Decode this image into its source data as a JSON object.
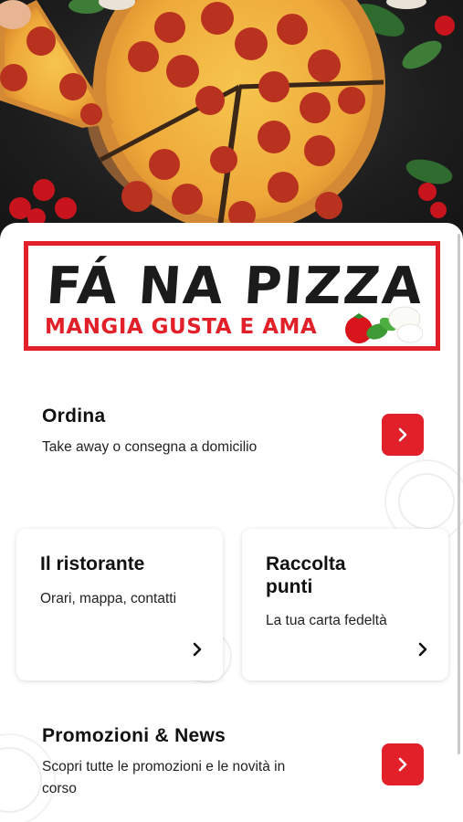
{
  "hero": {
    "image": "pepperoni-pizza-photo"
  },
  "logo": {
    "title": "FÁ NA PIZZA",
    "subtitle": "MANGIA GUSTA E AMA",
    "border_color": "#e2202a"
  },
  "order": {
    "title": "Ordina",
    "description": "Take away o consegna a domicilio",
    "action_icon": "chevron-right-icon"
  },
  "restaurant": {
    "title": "Il ristorante",
    "description": "Orari, mappa, contatti",
    "action_icon": "chevron-right-icon"
  },
  "loyalty": {
    "title_line1": "Raccolta",
    "title_line2": "punti",
    "description": "La tua carta fedeltà",
    "action_icon": "chevron-right-icon"
  },
  "promotions": {
    "title": "Promozioni & News",
    "description_line1": "Scopri tutte le promozioni e le novità in",
    "description_line2": "corso",
    "action_icon": "chevron-right-icon"
  },
  "colors": {
    "accent": "#e2202a",
    "text": "#111111"
  }
}
